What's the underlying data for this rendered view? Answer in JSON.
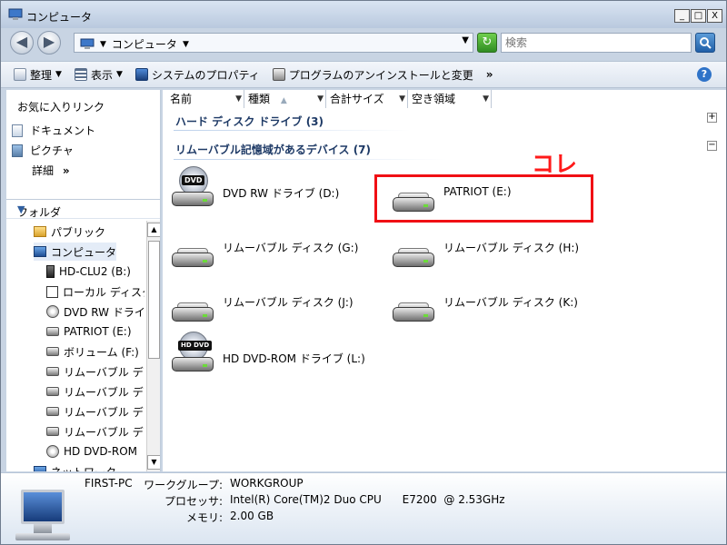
{
  "window": {
    "title": "コンピュータ"
  },
  "title_buttons": {
    "minimize": "_",
    "maximize": "□",
    "close": "X"
  },
  "address": {
    "path": "コンピュータ",
    "dropdown_glyph": "▼"
  },
  "search": {
    "placeholder": "検索"
  },
  "toolbar": {
    "organize": "整理",
    "views": "表示",
    "system_properties": "システムのプロパティ",
    "uninstall": "プログラムのアンインストールと変更",
    "more": "»",
    "help": "?"
  },
  "favorites": {
    "title": "お気に入りリンク",
    "links": [
      "ドキュメント",
      "ピクチャ"
    ],
    "more": "詳細",
    "more_glyph": "»"
  },
  "folders": {
    "title": "フォルダ",
    "items": [
      {
        "label": "パブリック",
        "icon": "folder-icon"
      },
      {
        "label": "コンピュータ",
        "icon": "computer-icon",
        "selected": true
      },
      {
        "label": "HD-CLU2 (B:)",
        "icon": "external-drive-icon"
      },
      {
        "label": "ローカル ディスク",
        "icon": "local-disk-icon"
      },
      {
        "label": "DVD RW ドライブ",
        "icon": "dvd-drive-icon"
      },
      {
        "label": "PATRIOT (E:)",
        "icon": "removable-drive-icon"
      },
      {
        "label": "ボリューム (F:)",
        "icon": "volume-icon"
      },
      {
        "label": "リムーバブル デ",
        "icon": "removable-drive-icon"
      },
      {
        "label": "リムーバブル デ",
        "icon": "removable-drive-icon"
      },
      {
        "label": "リムーバブル デ",
        "icon": "removable-drive-icon"
      },
      {
        "label": "リムーバブル デ",
        "icon": "removable-drive-icon"
      },
      {
        "label": "HD DVD-ROM",
        "icon": "hd-dvd-drive-icon"
      },
      {
        "label": "ネットワーク",
        "icon": "network-icon"
      }
    ]
  },
  "columns": [
    "名前",
    "種類",
    "合計サイズ",
    "空き領域"
  ],
  "groups": [
    {
      "title": "ハード ディスク ドライブ (3)",
      "toggle": "+"
    },
    {
      "title": "リムーバブル記憶域があるデバイス (7)",
      "toggle": "−"
    }
  ],
  "drives": [
    {
      "label": "DVD RW ドライブ (D:)",
      "kind": "dvd",
      "disc_label": "DVD"
    },
    {
      "label": "PATRIOT (E:)",
      "kind": "removable"
    },
    {
      "label": "リムーバブル ディスク (G:)",
      "kind": "removable"
    },
    {
      "label": "リムーバブル ディスク (H:)",
      "kind": "removable"
    },
    {
      "label": "リムーバブル ディスク (J:)",
      "kind": "removable"
    },
    {
      "label": "リムーバブル ディスク (K:)",
      "kind": "removable"
    },
    {
      "label": "HD DVD-ROM ドライブ (L:)",
      "kind": "hddvd",
      "disc_label": "HD DVD"
    }
  ],
  "annotation": {
    "text": "コレ",
    "color": "#ff1a1a"
  },
  "details": {
    "computer_name": "FIRST-PC",
    "workgroup_label": "ワークグループ:",
    "workgroup": "WORKGROUP",
    "processor_label": "プロセッサ:",
    "processor": "Intel(R) Core(TM)2 Duo CPU      E7200  @ 2.53GHz",
    "memory_label": "メモリ:",
    "memory": "2.00 GB"
  }
}
